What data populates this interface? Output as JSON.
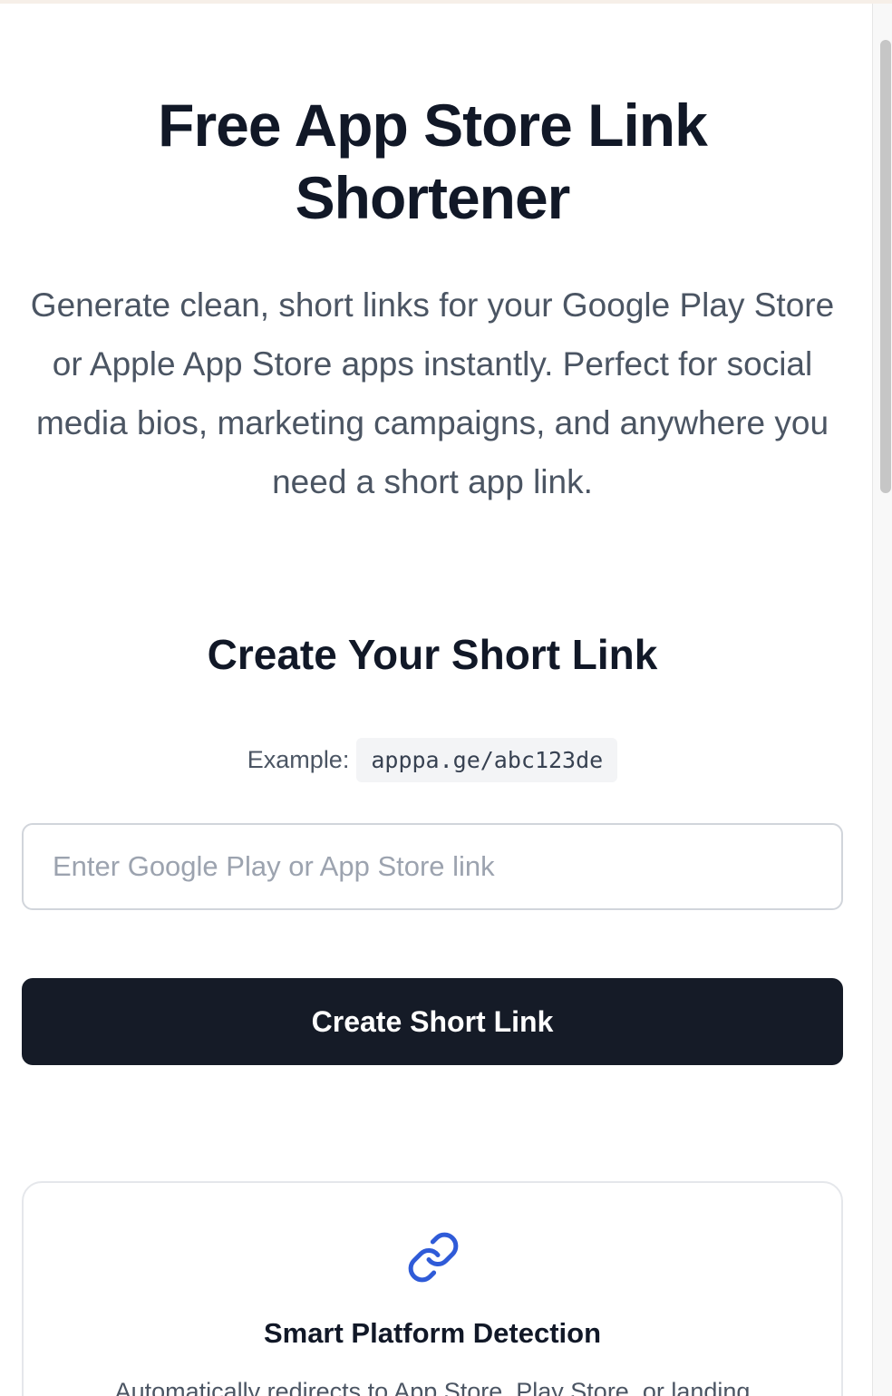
{
  "hero": {
    "title_line1": "Free App Store Link",
    "title_line2": "Shortener",
    "description": "Generate clean, short links for your Google Play Store or Apple App Store apps instantly. Perfect for social media bios, marketing campaigns, and anywhere you need a short app link."
  },
  "form": {
    "title": "Create Your Short Link",
    "example_label": "Example:",
    "example_value": "apppa.ge/abc123de",
    "input_value": "",
    "input_placeholder": "Enter Google Play or App Store link",
    "submit_label": "Create Short Link"
  },
  "features": [
    {
      "icon": "link-icon",
      "title": "Smart Platform Detection",
      "description": "Automatically redirects to App Store, Play Store, or landing"
    }
  ],
  "colors": {
    "heading": "#111827",
    "body_text": "#4b5563",
    "button_bg": "#151b27",
    "icon_accent": "#2f5bd8",
    "border": "#d1d5db"
  }
}
